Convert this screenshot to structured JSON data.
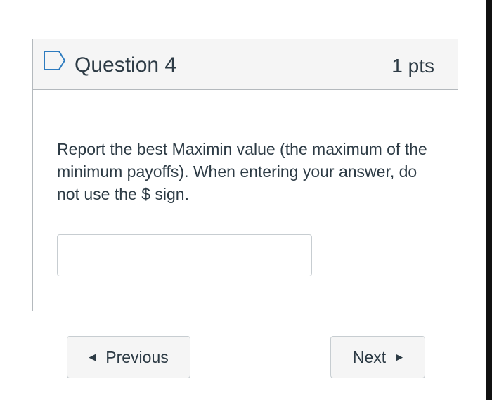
{
  "question": {
    "title": "Question 4",
    "points": "1 pts",
    "text": "Report the best Maximin value (the maximum of the minimum payoffs). When entering your answer, do not use the $ sign.",
    "answer_value": "",
    "flag_icon": "flag-outline-icon"
  },
  "navigation": {
    "previous_label": "Previous",
    "next_label": "Next",
    "previous_icon": "caret-left-icon",
    "next_icon": "caret-right-icon"
  },
  "colors": {
    "text": "#2d3b45",
    "header_bg": "#f5f5f5",
    "border": "#b4b9bd",
    "button_bg": "#f5f5f5"
  }
}
